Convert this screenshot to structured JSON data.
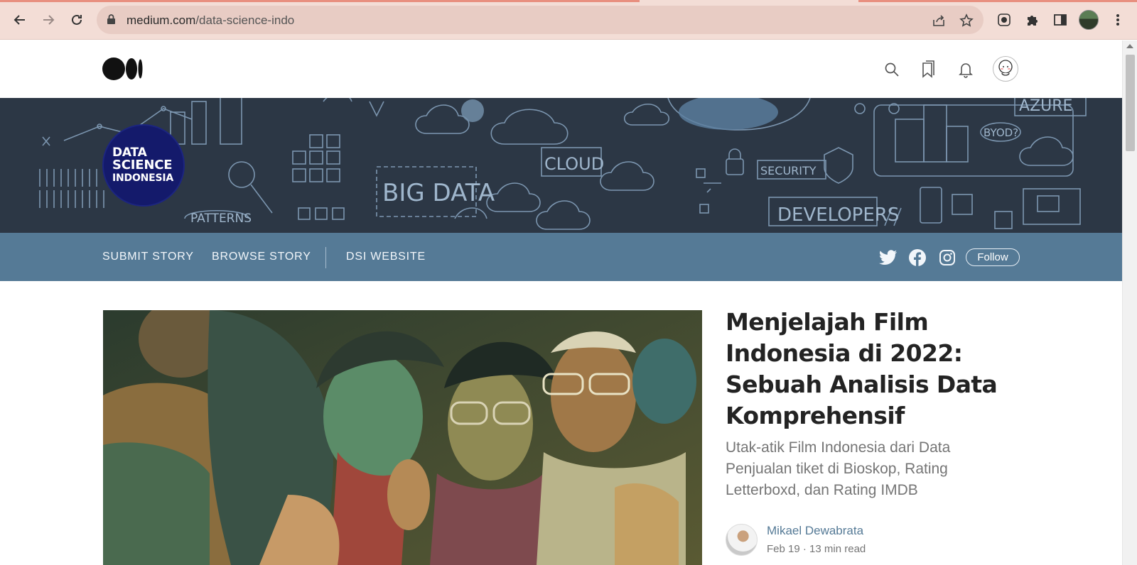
{
  "browser": {
    "url_host": "medium.com",
    "url_path": "/data-science-indo"
  },
  "publication": {
    "logo_lines": [
      "DATA",
      "SCIENCE",
      "INDONESIA"
    ],
    "banner_words": [
      "BIG DATA",
      "CLOUD",
      "SECURITY",
      "DEVELOPERS",
      "PATTERNS",
      "AZURE",
      "BYOD?"
    ],
    "nav": {
      "submit_story": "SUBMIT STORY",
      "browse_story": "BROWSE STORY",
      "dsi_website": "DSI WEBSITE"
    },
    "follow_label": "Follow"
  },
  "article": {
    "title": "Menjelajah Film Indonesia di 2022: Sebuah Analisis Data Komprehensif",
    "subtitle": "Utak-atik Film Indonesia dari Data Penjualan tiket di Bioskop, Rating Letterboxd, dan Rating IMDB",
    "author": "Mikael Dewabrata",
    "date": "Feb 19",
    "read_time": "13 min read"
  },
  "colors": {
    "chrome_bg": "#f3ddd6",
    "banner_bg": "#2c3745",
    "pub_nav_bg": "#557a96",
    "accent": "#557a96"
  },
  "icons": [
    "back-arrow-icon",
    "forward-arrow-icon",
    "reload-icon",
    "lock-icon",
    "share-icon",
    "star-icon",
    "extension-icon",
    "puzzle-icon",
    "side-panel-icon",
    "kebab-menu-icon",
    "medium-logo-icon",
    "search-icon",
    "bookmarks-icon",
    "bell-icon",
    "twitter-icon",
    "facebook-icon",
    "instagram-icon"
  ]
}
